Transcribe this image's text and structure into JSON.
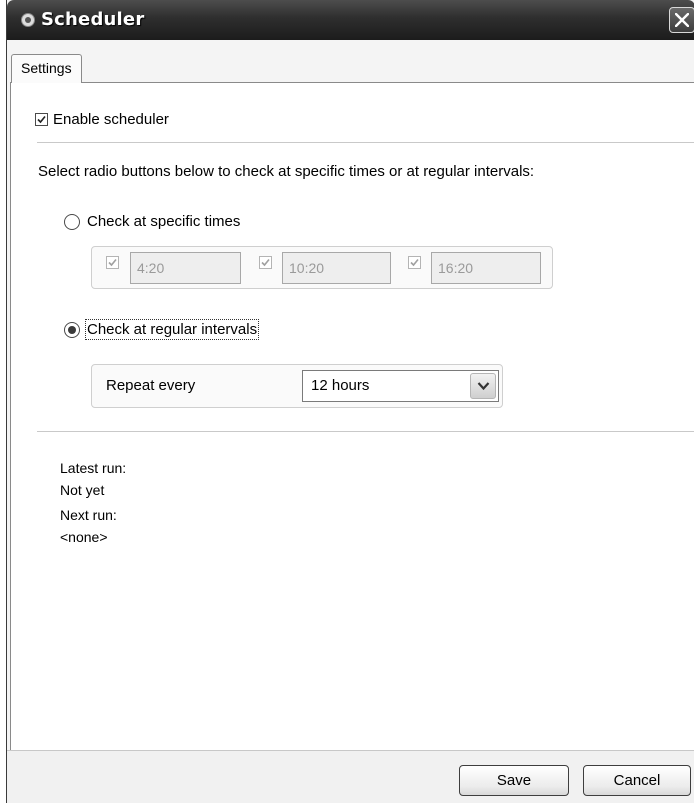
{
  "window": {
    "title": "Scheduler",
    "title_icon": "scheduler-app-icon",
    "close_icon": "close-icon"
  },
  "tabs": [
    {
      "label": "Settings",
      "active": true
    }
  ],
  "enable_scheduler": {
    "label": "Enable scheduler",
    "checked": true
  },
  "instructions": "Select radio buttons below to check at specific times or at regular intervals:",
  "specific_times": {
    "label": "Check at specific times",
    "selected": false,
    "times": [
      {
        "value": "4:20",
        "checked": true
      },
      {
        "value": "10:20",
        "checked": true
      },
      {
        "value": "16:20",
        "checked": true
      }
    ]
  },
  "regular_intervals": {
    "label": "Check at regular intervals",
    "selected": true,
    "repeat_label": "Repeat every",
    "repeat_value": "12 hours"
  },
  "status": {
    "latest_label": "Latest run:",
    "latest_value": "Not yet",
    "next_label": "Next run:",
    "next_value": "<none>"
  },
  "buttons": {
    "save": "Save",
    "cancel": "Cancel"
  },
  "colors": {
    "titlebar": "#2e2e2e",
    "panel_bg": "#ffffff",
    "window_bg": "#f4f4f4"
  }
}
